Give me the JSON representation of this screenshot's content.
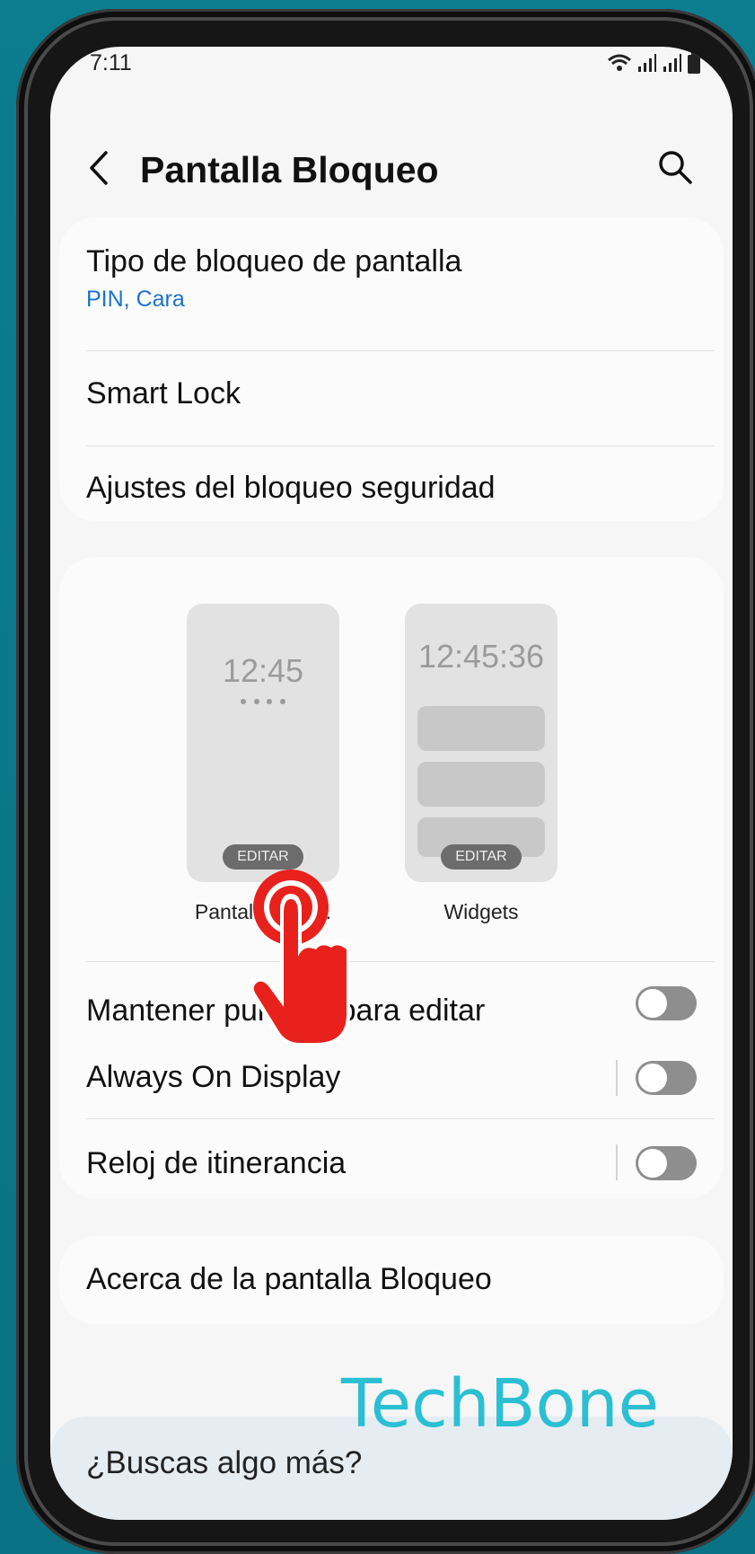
{
  "status_bar": {
    "time": "7:11"
  },
  "header": {
    "title": "Pantalla Bloqueo"
  },
  "security_section": {
    "items": [
      {
        "label": "Tipo de bloqueo de pantalla",
        "sub": "PIN, Cara"
      },
      {
        "label": "Smart Lock"
      },
      {
        "label": "Ajustes del bloqueo seguridad"
      }
    ]
  },
  "preview_section": {
    "thumbs": [
      {
        "clock": "12:45",
        "edit": "EDITAR",
        "caption": "Pantalla bloq..."
      },
      {
        "clock": "12:45:36",
        "edit": "EDITAR",
        "caption": "Widgets"
      }
    ],
    "toggles": [
      {
        "label": "Mantener pulsado para editar",
        "on": false
      },
      {
        "label": "Always On Display",
        "on": false
      },
      {
        "label": "Reloj de itinerancia",
        "on": false
      }
    ]
  },
  "about": {
    "label": "Acerca de la pantalla Bloqueo"
  },
  "looking": {
    "label": "¿Buscas algo más?"
  },
  "watermark": "TechBone",
  "colors": {
    "accent": "#1a73c9",
    "tap_hand": "#e8211c",
    "background": "#0c7a8c"
  }
}
